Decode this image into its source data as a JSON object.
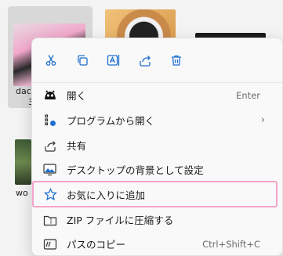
{
  "background": {
    "file_labels": [
      "dac",
      "3",
      "wo"
    ]
  },
  "toolbar": {
    "cut_icon": "scissors-icon",
    "copy_icon": "copy-icon",
    "rename_icon": "rename-icon",
    "share_icon": "share-icon",
    "delete_icon": "trash-icon"
  },
  "menu": {
    "items": [
      {
        "label": "開く",
        "shortcut": "Enter",
        "icon": "open-app-icon"
      },
      {
        "label": "プログラムから開く",
        "submenu_glyph": "›",
        "icon": "open-with-icon"
      },
      {
        "label": "共有",
        "icon": "share-icon"
      },
      {
        "label": "デスクトップの背景として設定",
        "icon": "wallpaper-icon"
      },
      {
        "label": "お気に入りに追加",
        "icon": "star-icon"
      },
      {
        "label": "ZIP ファイルに圧縮する",
        "icon": "zip-folder-icon"
      },
      {
        "label": "パスのコピー",
        "shortcut": "Ctrl+Shift+C",
        "icon": "copy-path-icon"
      }
    ]
  },
  "colors": {
    "accent": "#1f6fcf",
    "highlight_border": "#f4a4c8",
    "menu_bg": "#f9f9f9"
  }
}
